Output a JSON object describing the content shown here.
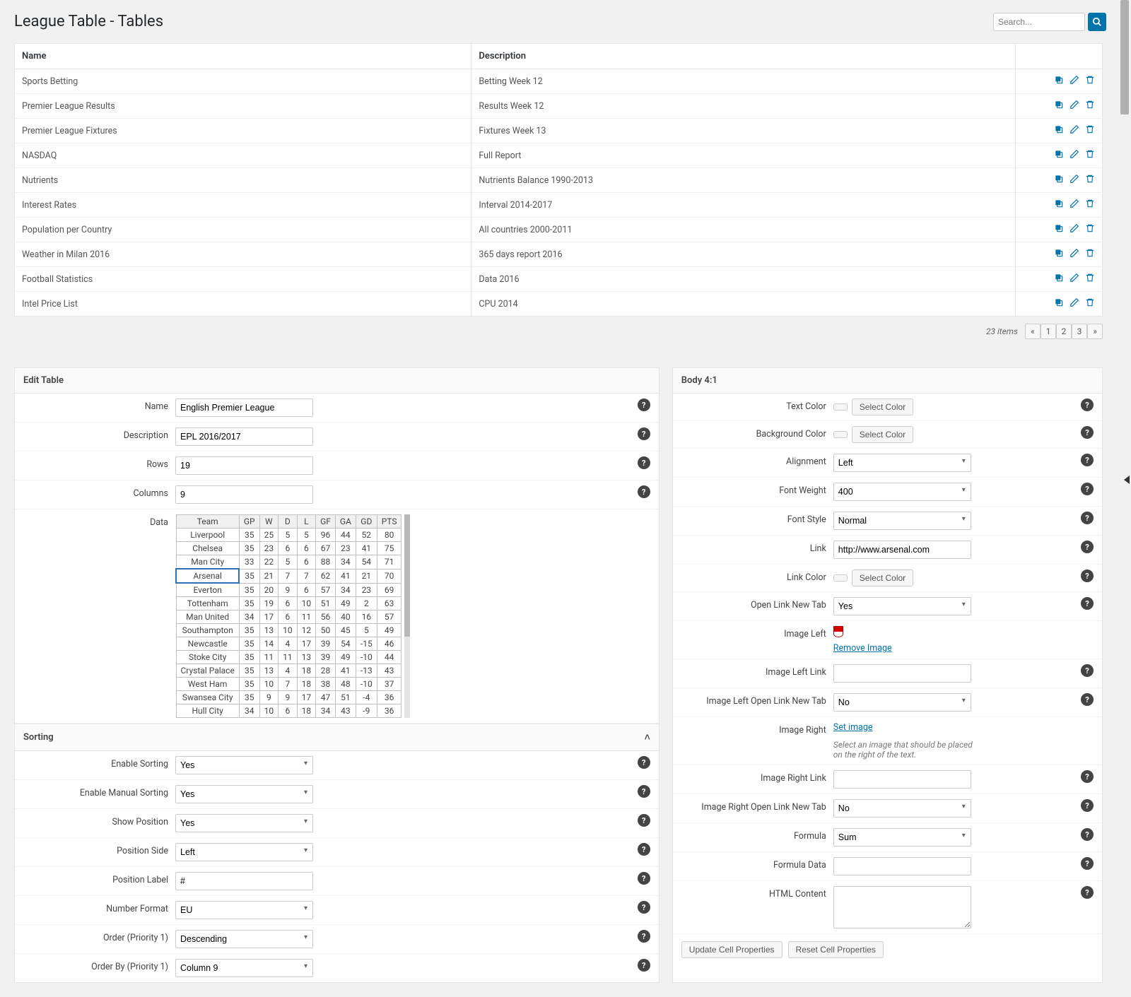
{
  "page_title": "League Table - Tables",
  "search_placeholder": "Search...",
  "list": {
    "headers": {
      "name": "Name",
      "description": "Description"
    },
    "rows": [
      {
        "name": "Sports Betting",
        "description": "Betting Week 12"
      },
      {
        "name": "Premier League Results",
        "description": "Results Week 12"
      },
      {
        "name": "Premier League Fixtures",
        "description": "Fixtures Week 13"
      },
      {
        "name": "NASDAQ",
        "description": "Full Report"
      },
      {
        "name": "Nutrients",
        "description": "Nutrients Balance 1990-2013"
      },
      {
        "name": "Interest Rates",
        "description": "Interval 2014-2017"
      },
      {
        "name": "Population per Country",
        "description": "All countries 2000-2011"
      },
      {
        "name": "Weather in Milan 2016",
        "description": "365 days report 2016"
      },
      {
        "name": "Football Statistics",
        "description": "Data 2016"
      },
      {
        "name": "Intel Price List",
        "description": "CPU 2014"
      }
    ]
  },
  "pagination": {
    "count": "23",
    "label": "items",
    "pages": [
      "«",
      "1",
      "2",
      "3",
      "»"
    ]
  },
  "edit": {
    "title": "Edit Table",
    "name_label": "Name",
    "name_value": "English Premier League",
    "desc_label": "Description",
    "desc_value": "EPL 2016/2017",
    "rows_label": "Rows",
    "rows_value": "19",
    "cols_label": "Columns",
    "cols_value": "9",
    "data_label": "Data",
    "grid_headers": [
      "Team",
      "GP",
      "W",
      "D",
      "L",
      "GF",
      "GA",
      "GD",
      "PTS"
    ],
    "grid_rows": [
      [
        "Liverpool",
        "35",
        "25",
        "5",
        "5",
        "96",
        "44",
        "52",
        "80"
      ],
      [
        "Chelsea",
        "35",
        "23",
        "6",
        "6",
        "67",
        "23",
        "41",
        "75"
      ],
      [
        "Man City",
        "33",
        "22",
        "5",
        "6",
        "88",
        "34",
        "54",
        "71"
      ],
      [
        "Arsenal",
        "35",
        "21",
        "7",
        "7",
        "62",
        "41",
        "21",
        "70"
      ],
      [
        "Everton",
        "35",
        "20",
        "9",
        "6",
        "57",
        "34",
        "23",
        "69"
      ],
      [
        "Tottenham",
        "35",
        "19",
        "6",
        "10",
        "51",
        "49",
        "2",
        "63"
      ],
      [
        "Man United",
        "34",
        "17",
        "6",
        "11",
        "56",
        "40",
        "16",
        "57"
      ],
      [
        "Southampton",
        "35",
        "13",
        "10",
        "12",
        "50",
        "45",
        "5",
        "49"
      ],
      [
        "Newcastle",
        "35",
        "14",
        "4",
        "17",
        "39",
        "54",
        "-15",
        "46"
      ],
      [
        "Stoke City",
        "35",
        "11",
        "11",
        "13",
        "39",
        "49",
        "-10",
        "44"
      ],
      [
        "Crystal Palace",
        "35",
        "13",
        "4",
        "18",
        "28",
        "41",
        "-13",
        "43"
      ],
      [
        "West Ham",
        "35",
        "10",
        "7",
        "18",
        "38",
        "48",
        "-10",
        "37"
      ],
      [
        "Swansea City",
        "35",
        "9",
        "9",
        "17",
        "47",
        "51",
        "-4",
        "36"
      ],
      [
        "Hull City",
        "34",
        "10",
        "6",
        "18",
        "34",
        "43",
        "-9",
        "36"
      ]
    ],
    "selected_row": 3
  },
  "sorting": {
    "title": "Sorting",
    "enable_label": "Enable Sorting",
    "enable_value": "Yes",
    "manual_label": "Enable Manual Sorting",
    "manual_value": "Yes",
    "position_label": "Show Position",
    "position_value": "Yes",
    "side_label": "Position Side",
    "side_value": "Left",
    "plabel_label": "Position Label",
    "plabel_value": "#",
    "number_label": "Number Format",
    "number_value": "EU",
    "order_label": "Order (Priority 1)",
    "order_value": "Descending",
    "orderby_label": "Order By (Priority 1)",
    "orderby_value": "Column 9"
  },
  "body": {
    "title": "Body 4:1",
    "select_color": "Select Color",
    "textcolor_label": "Text Color",
    "bgcolor_label": "Background Color",
    "align_label": "Alignment",
    "align_value": "Left",
    "weight_label": "Font Weight",
    "weight_value": "400",
    "style_label": "Font Style",
    "style_value": "Normal",
    "link_label": "Link",
    "link_value": "http://www.arsenal.com",
    "linkcolor_label": "Link Color",
    "newtab_label": "Open Link New Tab",
    "newtab_value": "Yes",
    "imgleft_label": "Image Left",
    "remove_image": "Remove Image",
    "imgleft_link_label": "Image Left Link",
    "imgleft_link_value": "",
    "imgleft_tab_label": "Image Left Open Link New Tab",
    "imgleft_tab_value": "No",
    "imgright_label": "Image Right",
    "set_image": "Set image",
    "imgright_desc": "Select an image that should be placed on the right of the text.",
    "imgright_link_label": "Image Right Link",
    "imgright_link_value": "",
    "imgright_tab_label": "Image Right Open Link New Tab",
    "imgright_tab_value": "No",
    "formula_label": "Formula",
    "formula_value": "Sum",
    "formula_data_label": "Formula Data",
    "formula_data_value": "",
    "html_label": "HTML Content",
    "html_value": "",
    "update_btn": "Update Cell Properties",
    "reset_btn": "Reset Cell Properties"
  }
}
